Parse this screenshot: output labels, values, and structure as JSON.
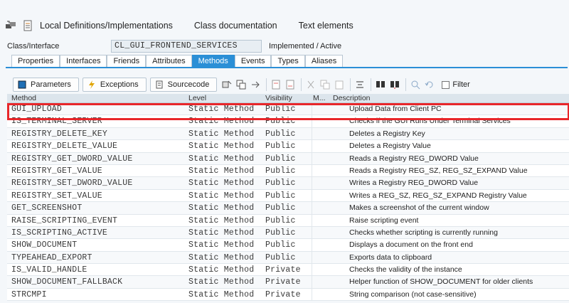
{
  "toolbar": {
    "items": [
      {
        "label": "Local Definitions/Implementations"
      },
      {
        "label": "Class documentation"
      },
      {
        "label": "Text elements"
      }
    ]
  },
  "class_info": {
    "label": "Class/Interface",
    "value": "CL_GUI_FRONTEND_SERVICES",
    "status": "Implemented / Active"
  },
  "tabs": [
    {
      "label": "Properties",
      "active": false
    },
    {
      "label": "Interfaces",
      "active": false
    },
    {
      "label": "Friends",
      "active": false
    },
    {
      "label": "Attributes",
      "active": false
    },
    {
      "label": "Methods",
      "active": true
    },
    {
      "label": "Events",
      "active": false
    },
    {
      "label": "Types",
      "active": false
    },
    {
      "label": "Aliases",
      "active": false
    }
  ],
  "subtoolbar": {
    "parameters": "Parameters",
    "exceptions": "Exceptions",
    "sourcecode": "Sourcecode",
    "filter": "Filter"
  },
  "grid": {
    "headers": {
      "method": "Method",
      "level": "Level",
      "visibility": "Visibility",
      "m": "M...",
      "description": "Description"
    },
    "rows": [
      {
        "method": "GUI_UPLOAD",
        "level": "Static Method",
        "visibility": "Public",
        "description": "Upload Data from Client PC"
      },
      {
        "method": "IS_TERMINAL_SERVER",
        "level": "Static Method",
        "visibility": "Public",
        "description": "Checks if the GUI Runs Under Terminal Services"
      },
      {
        "method": "REGISTRY_DELETE_KEY",
        "level": "Static Method",
        "visibility": "Public",
        "description": "Deletes a Registry Key"
      },
      {
        "method": "REGISTRY_DELETE_VALUE",
        "level": "Static Method",
        "visibility": "Public",
        "description": "Deletes a Registry Value"
      },
      {
        "method": "REGISTRY_GET_DWORD_VALUE",
        "level": "Static Method",
        "visibility": "Public",
        "description": "Reads a Registry REG_DWORD Value"
      },
      {
        "method": "REGISTRY_GET_VALUE",
        "level": "Static Method",
        "visibility": "Public",
        "description": "Reads a Registry REG_SZ, REG_SZ_EXPAND Value"
      },
      {
        "method": "REGISTRY_SET_DWORD_VALUE",
        "level": "Static Method",
        "visibility": "Public",
        "description": "Writes a Registry REG_DWORD Value"
      },
      {
        "method": "REGISTRY_SET_VALUE",
        "level": "Static Method",
        "visibility": "Public",
        "description": "Writes a REG_SZ, REG_SZ_EXPAND Registry Value"
      },
      {
        "method": "GET_SCREENSHOT",
        "level": "Static Method",
        "visibility": "Public",
        "description": "Makes a screenshot of the current window"
      },
      {
        "method": "RAISE_SCRIPTING_EVENT",
        "level": "Static Method",
        "visibility": "Public",
        "description": "Raise scripting event"
      },
      {
        "method": "IS_SCRIPTING_ACTIVE",
        "level": "Static Method",
        "visibility": "Public",
        "description": "Checks whether scripting is currently running"
      },
      {
        "method": "SHOW_DOCUMENT",
        "level": "Static Method",
        "visibility": "Public",
        "description": "Displays a document on the front end"
      },
      {
        "method": "TYPEAHEAD_EXPORT",
        "level": "Static Method",
        "visibility": "Public",
        "description": "Exports data to clipboard"
      },
      {
        "method": "IS_VALID_HANDLE",
        "level": "Static Method",
        "visibility": "Private",
        "description": "Checks the validity of the instance"
      },
      {
        "method": "SHOW_DOCUMENT_FALLBACK",
        "level": "Static Method",
        "visibility": "Private",
        "description": "Helper function of SHOW_DOCUMENT for older clients"
      },
      {
        "method": "STRCMPI",
        "level": "Static Method",
        "visibility": "Private",
        "description": "String comparison (not case-sensitive)"
      }
    ]
  },
  "colors": {
    "accent": "#2b8fd6",
    "highlight": "#e8262a"
  }
}
